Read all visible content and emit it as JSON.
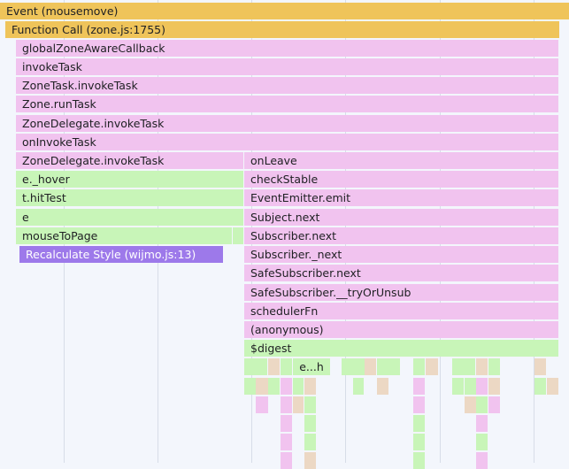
{
  "flame": {
    "event": "Event (mousemove)",
    "function_call": "Function Call (zone.js:1755)",
    "left_stack": [
      "globalZoneAwareCallback",
      "invokeTask",
      "ZoneTask.invokeTask",
      "Zone.runTask",
      "ZoneDelegate.invokeTask",
      "onInvokeTask",
      "ZoneDelegate.invokeTask",
      "e._hover",
      "t.hitTest",
      "e",
      "mouseToPage",
      "Recalculate Style (wijmo.js:13)"
    ],
    "right_stack": [
      "onLeave",
      "checkStable",
      "EventEmitter.emit",
      "Subject.next",
      "Subscriber.next",
      "Subscriber._next",
      "SafeSubscriber.next",
      "SafeSubscriber.__tryOrUnsub",
      "schedulerFn",
      "(anonymous)",
      "$digest"
    ],
    "truncated_label": "e...h"
  },
  "colors": {
    "background": "#f3f6fc",
    "event_bar": "#efc45a",
    "scripting_pink": "#f1c3ef",
    "scripting_green": "#c8f5b8",
    "rendering_violet": "#9d79ea",
    "other_tan": "#ecd8c4"
  }
}
